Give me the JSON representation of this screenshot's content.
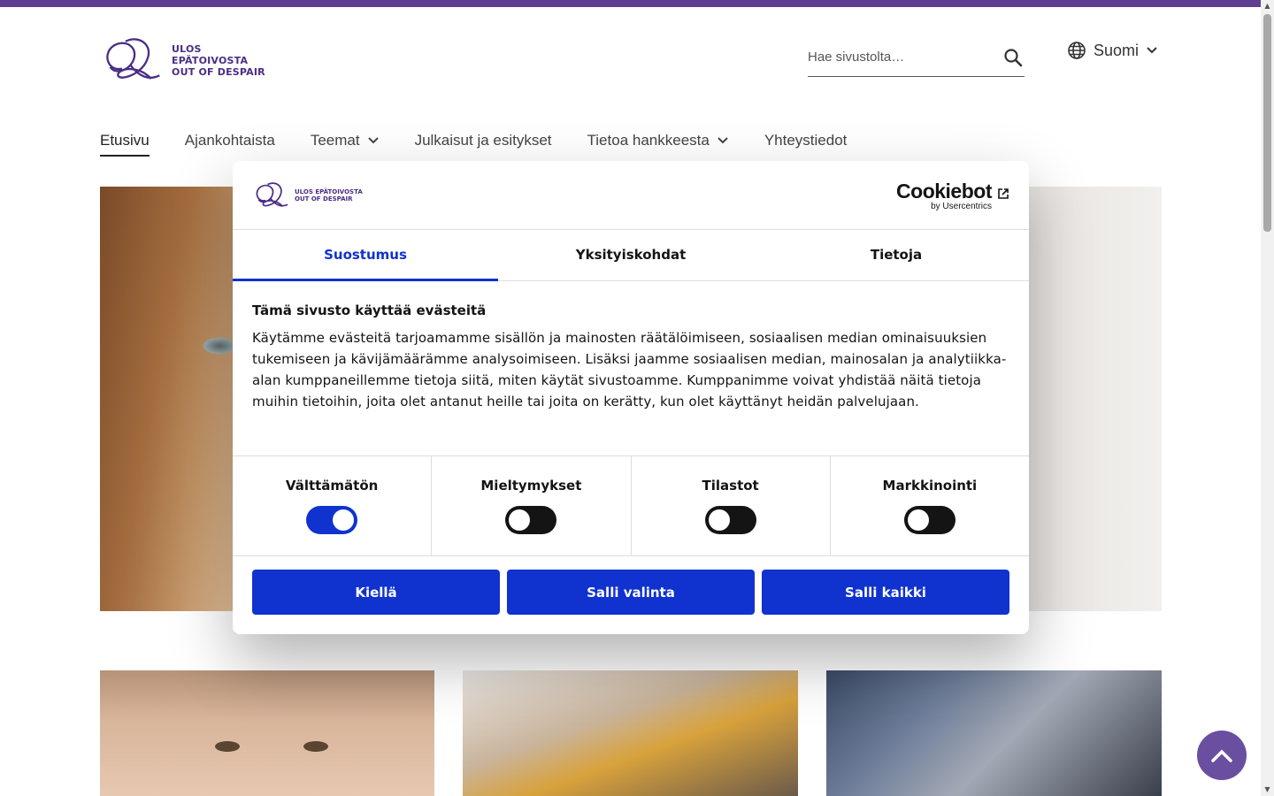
{
  "header": {
    "logo_line1": "ULOS EPÄTOIVOSTA",
    "logo_line2": "OUT OF DESPAIR",
    "search_placeholder": "Hae sivustolta…",
    "language": "Suomi"
  },
  "nav": {
    "items": [
      {
        "label": "Etusivu",
        "active": true,
        "dropdown": false
      },
      {
        "label": "Ajankohtaista",
        "active": false,
        "dropdown": false
      },
      {
        "label": "Teemat",
        "active": false,
        "dropdown": true
      },
      {
        "label": "Julkaisut ja esitykset",
        "active": false,
        "dropdown": false
      },
      {
        "label": "Tietoa hankkeesta",
        "active": false,
        "dropdown": true
      },
      {
        "label": "Yhteystiedot",
        "active": false,
        "dropdown": false
      }
    ]
  },
  "cookie_dialog": {
    "brand": "Cookiebot",
    "brand_sub": "by Usercentrics",
    "tabs": [
      "Suostumus",
      "Yksityiskohdat",
      "Tietoja"
    ],
    "active_tab": 0,
    "heading": "Tämä sivusto käyttää evästeitä",
    "text": "Käytämme evästeitä tarjoamamme sisällön ja mainosten räätälöimiseen, sosiaalisen median ominaisuuksien tukemiseen ja kävijämäärämme analysoimiseen. Lisäksi jaamme sosiaalisen median, mainosalan ja analytiikka-alan kumppaneillemme tietoja siitä, miten käytät sivustoamme. Kumppanimme voivat yhdistää näitä tietoja muihin tietoihin, joita olet antanut heille tai joita on kerätty, kun olet käyttänyt heidän palvelujaan.",
    "toggles": [
      {
        "label": "Välttämätön",
        "on": true
      },
      {
        "label": "Mieltymykset",
        "on": false
      },
      {
        "label": "Tilastot",
        "on": false
      },
      {
        "label": "Markkinointi",
        "on": false
      }
    ],
    "buttons": {
      "deny": "Kiellä",
      "allow_selection": "Salli valinta",
      "allow_all": "Salli kaikki"
    }
  },
  "colors": {
    "brand_purple": "#5f3d8f",
    "cookiebot_blue": "#1032cf"
  }
}
